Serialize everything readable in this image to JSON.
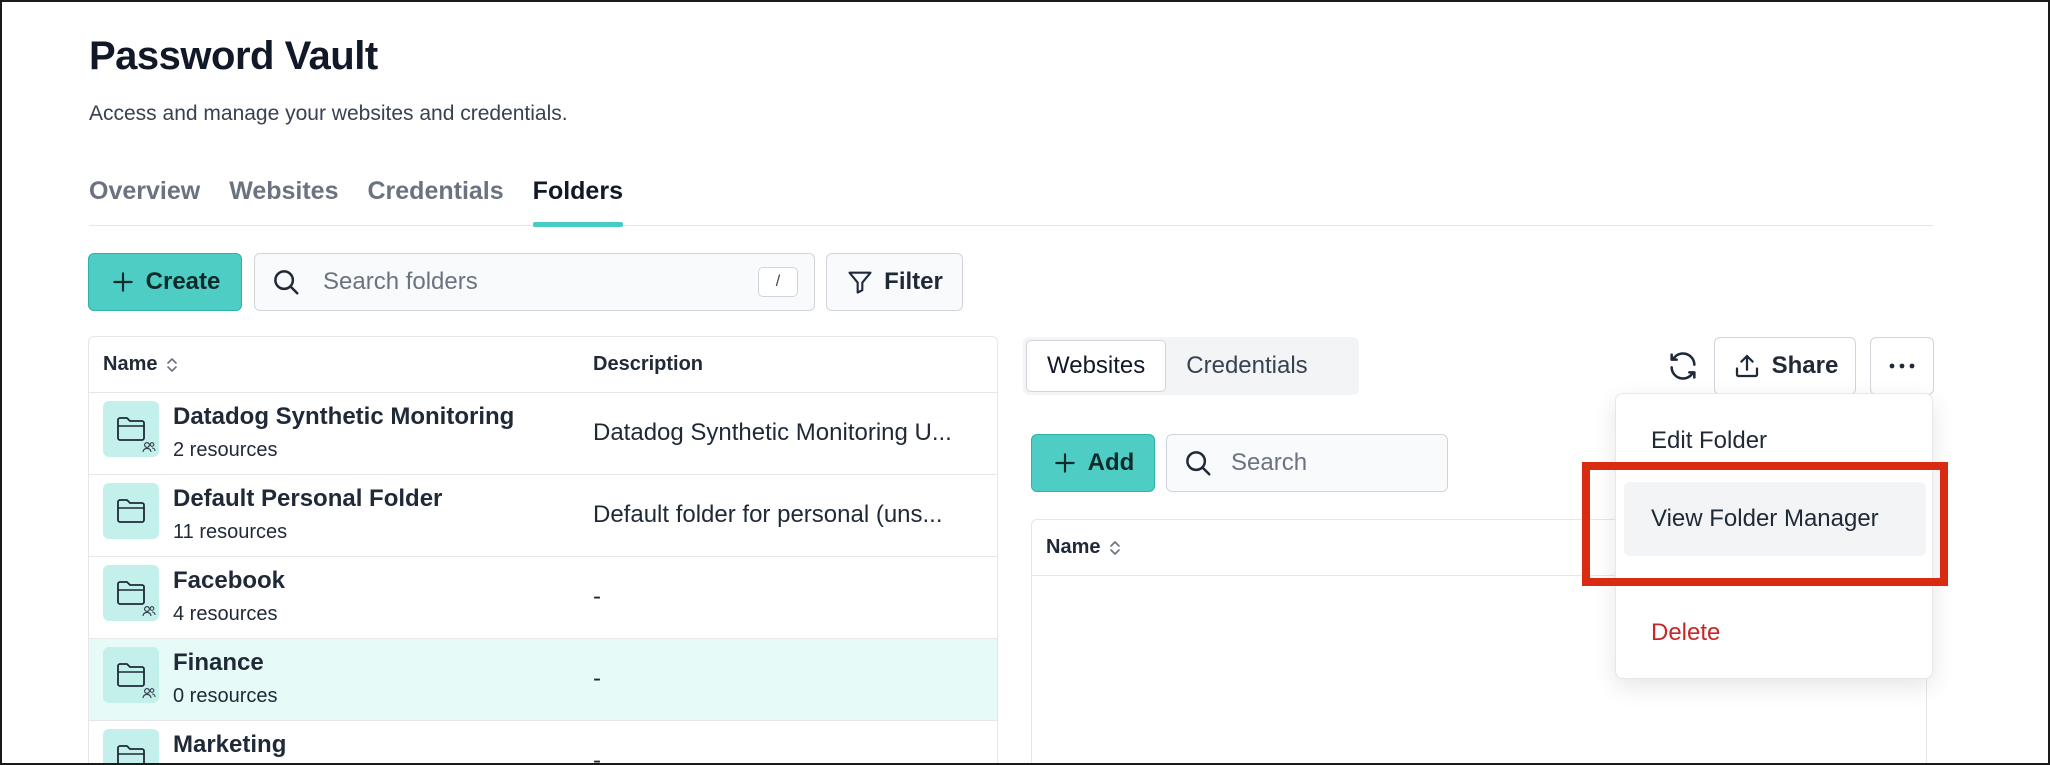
{
  "page": {
    "title": "Password Vault",
    "subtitle": "Access and manage your websites and credentials."
  },
  "tabs": [
    {
      "label": "Overview",
      "active": false
    },
    {
      "label": "Websites",
      "active": false
    },
    {
      "label": "Credentials",
      "active": false
    },
    {
      "label": "Folders",
      "active": true
    }
  ],
  "toolbar": {
    "create_label": "Create",
    "search_placeholder": "Search folders",
    "search_shortcut": "/",
    "filter_label": "Filter"
  },
  "folders_table": {
    "headers": {
      "name": "Name",
      "description": "Description"
    },
    "rows": [
      {
        "name": "Datadog Synthetic Monitoring",
        "count": "2 resources",
        "description": "Datadog Synthetic Monitoring U...",
        "shared": true,
        "selected": false
      },
      {
        "name": "Default Personal Folder",
        "count": "11 resources",
        "description": "Default folder for personal (uns...",
        "shared": false,
        "selected": false
      },
      {
        "name": "Facebook",
        "count": "4 resources",
        "description": "-",
        "shared": true,
        "selected": false
      },
      {
        "name": "Finance",
        "count": "0 resources",
        "description": "-",
        "shared": true,
        "selected": true
      },
      {
        "name": "Marketing",
        "count": "",
        "description": "-",
        "shared": true,
        "selected": false
      }
    ]
  },
  "detail": {
    "segments": [
      {
        "label": "Websites",
        "active": true
      },
      {
        "label": "Credentials",
        "active": false
      }
    ],
    "share_label": "Share",
    "add_label": "Add",
    "search_placeholder": "Search",
    "table_header_name": "Name"
  },
  "menu": {
    "items": [
      {
        "label": "Edit Folder",
        "hover": false,
        "danger": false
      },
      {
        "label": "View Folder Manager",
        "hover": true,
        "danger": false
      },
      {
        "label": "Delete",
        "hover": false,
        "danger": true
      }
    ]
  },
  "colors": {
    "accent": "#4ecdc4",
    "selected_row": "#e6faf8",
    "danger": "#c62828",
    "annotation": "#d92b12"
  }
}
